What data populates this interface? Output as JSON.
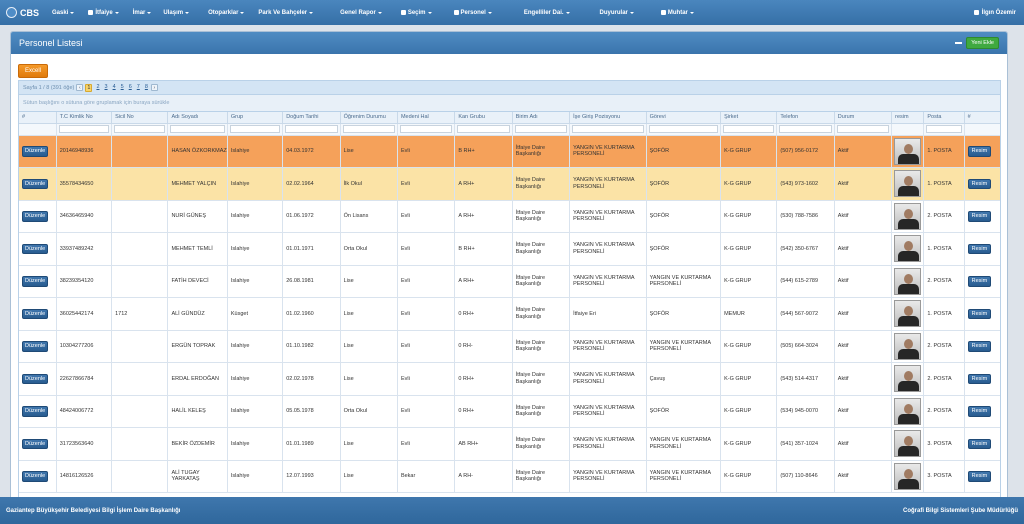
{
  "brand": "CBS",
  "menu": [
    {
      "label": "Gaski",
      "icon": ""
    },
    {
      "label": "İtfaiye",
      "icon": "fire-icon"
    },
    {
      "label": "İmar",
      "icon": ""
    },
    {
      "label": "Ulaşım",
      "icon": ""
    },
    {
      "label": "Otoparklar",
      "icon": ""
    },
    {
      "label": "Park Ve Bahçeler",
      "icon": ""
    },
    {
      "label": "Genel Rapor",
      "icon": ""
    },
    {
      "label": "Seçim",
      "icon": "cog-icon"
    },
    {
      "label": "Personel",
      "icon": "users-icon"
    },
    {
      "label": "Engelliler Dai.",
      "icon": ""
    },
    {
      "label": "Duyurular",
      "icon": ""
    },
    {
      "label": "Muhtar",
      "icon": "user-icon"
    }
  ],
  "user": {
    "name": "İlgın Özemir"
  },
  "panel": {
    "title": "Personel Listesi",
    "new_button": "Yeni Ekle",
    "excel_button": "Excell"
  },
  "pager": {
    "info": "Sayfa 1 / 8 (391 öğe)",
    "pages": [
      "1",
      "2",
      "3",
      "4",
      "5",
      "6",
      "7",
      "8"
    ],
    "current": "1"
  },
  "group_hint": "Sütun başlığını o sütuna göre gruplamak için buraya sürükle",
  "columns": [
    "#",
    "T.C Kimlik No",
    "Sicil No",
    "Adı Soyadı",
    "Grup",
    "Doğum Tarihi",
    "Öğrenim Durumu",
    "Medeni Hal",
    "Kan Grubu",
    "Birim Adı",
    "İşe Giriş Pozisyonu",
    "Görevi",
    "Şirket",
    "Telefon",
    "Durum",
    "resim",
    "Posta",
    "#"
  ],
  "row_labels": {
    "edit": "Düzenle",
    "photo": "Resim"
  },
  "rows": [
    {
      "tc": "20146948936",
      "sicil": "",
      "ad": "HASAN ÖZKORKMAZ",
      "grup": "Islahiye",
      "dogum": "04.03.1972",
      "ogrenim": "Lise",
      "medeni": "Evli",
      "kan": "B RH+",
      "birim": "İtfaiye Daire Başkanlığı",
      "pozisyon": "YANGIN VE KURTARMA PERSONELİ",
      "gorev": "ŞOFÖR",
      "sirket": "K-G GRUP",
      "telefon": "(507) 956-0172",
      "durum": "Aktif",
      "posta": "1. POSTA"
    },
    {
      "tc": "35578434650",
      "sicil": "",
      "ad": "MEHMET YALÇIN",
      "grup": "Islahiye",
      "dogum": "02.02.1964",
      "ogrenim": "İlk Okul",
      "medeni": "Evli",
      "kan": "A RH+",
      "birim": "İtfaiye Daire Başkanlığı",
      "pozisyon": "YANGIN VE KURTARMA PERSONELİ",
      "gorev": "ŞOFÖR",
      "sirket": "K-G GRUP",
      "telefon": "(543) 973-1602",
      "durum": "Aktif",
      "posta": "1. POSTA"
    },
    {
      "tc": "34636465940",
      "sicil": "",
      "ad": "NURİ GÜNEŞ",
      "grup": "Islahiye",
      "dogum": "01.06.1972",
      "ogrenim": "Ön Lisans",
      "medeni": "Evli",
      "kan": "A RH+",
      "birim": "İtfaiye Daire Başkanlığı",
      "pozisyon": "YANGIN VE KURTARMA PERSONELİ",
      "gorev": "ŞOFÖR",
      "sirket": "K-G GRUP",
      "telefon": "(530) 788-7586",
      "durum": "Aktif",
      "posta": "2. POSTA"
    },
    {
      "tc": "33937489242",
      "sicil": "",
      "ad": "MEHMET TEMLİ",
      "grup": "Islahiye",
      "dogum": "01.01.1971",
      "ogrenim": "Orta Okul",
      "medeni": "Evli",
      "kan": "B RH+",
      "birim": "İtfaiye Daire Başkanlığı",
      "pozisyon": "YANGIN VE KURTARMA PERSONELİ",
      "gorev": "ŞOFÖR",
      "sirket": "K-G GRUP",
      "telefon": "(542) 350-6767",
      "durum": "Aktif",
      "posta": "1. POSTA"
    },
    {
      "tc": "38239354120",
      "sicil": "",
      "ad": "FATİH DEVECİ",
      "grup": "Islahiye",
      "dogum": "26.08.1981",
      "ogrenim": "Lise",
      "medeni": "Evli",
      "kan": "A RH+",
      "birim": "İtfaiye Daire Başkanlığı",
      "pozisyon": "YANGIN VE KURTARMA PERSONELİ",
      "gorev": "YANGIN VE KURTARMA PERSONELİ",
      "sirket": "K-G GRUP",
      "telefon": "(544) 615-2789",
      "durum": "Aktif",
      "posta": "2. POSTA"
    },
    {
      "tc": "36025442174",
      "sicil": "1712",
      "ad": "ALİ GÜNDÜZ",
      "grup": "Küsget",
      "dogum": "01.02.1960",
      "ogrenim": "Lise",
      "medeni": "Evli",
      "kan": "0 RH+",
      "birim": "İtfaiye Daire Başkanlığı",
      "pozisyon": "İtfaiye Eri",
      "gorev": "ŞOFÖR",
      "sirket": "MEMUR",
      "telefon": "(544) 567-9072",
      "durum": "Aktif",
      "posta": "1. POSTA"
    },
    {
      "tc": "10304277206",
      "sicil": "",
      "ad": "ERGÜN TOPRAK",
      "grup": "Islahiye",
      "dogum": "01.10.1982",
      "ogrenim": "Lise",
      "medeni": "Evli",
      "kan": "0 RH-",
      "birim": "İtfaiye Daire Başkanlığı",
      "pozisyon": "YANGIN VE KURTARMA PERSONELİ",
      "gorev": "YANGIN VE KURTARMA PERSONELİ",
      "sirket": "K-G GRUP",
      "telefon": "(505) 664-3024",
      "durum": "Aktif",
      "posta": "2. POSTA"
    },
    {
      "tc": "22627866784",
      "sicil": "",
      "ad": "ERDAL ERDOĞAN",
      "grup": "Islahiye",
      "dogum": "02.02.1978",
      "ogrenim": "Lise",
      "medeni": "Evli",
      "kan": "0 RH+",
      "birim": "İtfaiye Daire Başkanlığı",
      "pozisyon": "YANGIN VE KURTARMA PERSONELİ",
      "gorev": "Çavuş",
      "sirket": "K-G GRUP",
      "telefon": "(543) 514-4317",
      "durum": "Aktif",
      "posta": "2. POSTA"
    },
    {
      "tc": "48424006772",
      "sicil": "",
      "ad": "HALİL KELEŞ",
      "grup": "Islahiye",
      "dogum": "05.05.1978",
      "ogrenim": "Orta Okul",
      "medeni": "Evli",
      "kan": "0 RH+",
      "birim": "İtfaiye Daire Başkanlığı",
      "pozisyon": "YANGIN VE KURTARMA PERSONELİ",
      "gorev": "ŞOFÖR",
      "sirket": "K-G GRUP",
      "telefon": "(534) 945-0070",
      "durum": "Aktif",
      "posta": "2. POSTA"
    },
    {
      "tc": "31723563640",
      "sicil": "",
      "ad": "BEKİR ÖZDEMİR",
      "grup": "Islahiye",
      "dogum": "01.01.1989",
      "ogrenim": "Lise",
      "medeni": "Evli",
      "kan": "AB RH+",
      "birim": "İtfaiye Daire Başkanlığı",
      "pozisyon": "YANGIN VE KURTARMA PERSONELİ",
      "gorev": "YANGIN VE KURTARMA PERSONELİ",
      "sirket": "K-G GRUP",
      "telefon": "(541) 357-1024",
      "durum": "Aktif",
      "posta": "3. POSTA"
    },
    {
      "tc": "14816126526",
      "sicil": "",
      "ad": "ALİ TUGAY YARKATAŞ",
      "grup": "Islahiye",
      "dogum": "12.07.1993",
      "ogrenim": "Lise",
      "medeni": "Bekar",
      "kan": "A RH-",
      "birim": "İtfaiye Daire Başkanlığı",
      "pozisyon": "YANGIN VE KURTARMA PERSONELİ",
      "gorev": "YANGIN VE KURTARMA PERSONELİ",
      "sirket": "K-G GRUP",
      "telefon": "(507) 110-8646",
      "durum": "Aktif",
      "posta": "3. POSTA"
    }
  ],
  "footer": {
    "left": "Gaziantep Büyükşehir Belediyesi Bilgi İşlem Daire Başkanlığı",
    "right": "Coğrafi Bilgi Sistemleri Şube Müdürlüğü"
  },
  "colors": {
    "nav": "#3a74ac",
    "selected_row": "#f5a15a",
    "alt_row": "#fbe3a6",
    "button": "#285b8f",
    "new_button": "#3fa93f"
  }
}
